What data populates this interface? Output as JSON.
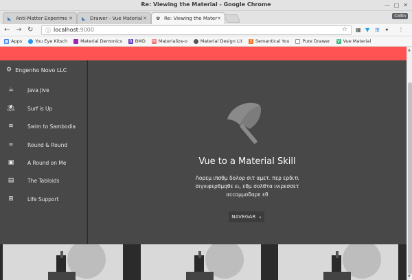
{
  "window": {
    "title": "Re: Viewing the Material - Google Chrome"
  },
  "tabs": [
    {
      "label": "Anti-Matter Experime",
      "active": false
    },
    {
      "label": "Drawer - Vue Material",
      "active": false
    },
    {
      "label": "Re: Viewing the Mater",
      "active": true
    }
  ],
  "profile": "Collin",
  "toolbar": {
    "url_host": "localhost",
    "url_port": ":9000"
  },
  "bookmarks": [
    {
      "label": "Apps",
      "icon": "apps-grid-icon",
      "color": "#4285f4"
    },
    {
      "label": "You Eye Kitsch",
      "icon": "swirl-icon",
      "color": "#2196f3"
    },
    {
      "label": "Material Demonics",
      "icon": "material-icon",
      "color": "#9c27b0"
    },
    {
      "label": "BMD",
      "icon": "bmd-icon",
      "color": "#673ab7"
    },
    {
      "label": "Materialize-o",
      "icon": "materialize-icon",
      "color": "#ee6e73"
    },
    {
      "label": "Material Design Lit",
      "icon": "mdl-icon",
      "color": "#555555"
    },
    {
      "label": "Semantical You",
      "icon": "semantic-icon",
      "color": "#f2711c"
    },
    {
      "label": "Pure Drawer",
      "icon": "page-icon",
      "color": "#888888"
    },
    {
      "label": "Vue Material",
      "icon": "vue-icon",
      "color": "#41b883"
    }
  ],
  "page": {
    "accent_color": "#ff5252",
    "brand": "Engenho Novo LLC",
    "menu": [
      {
        "label": "Java Jive",
        "icon": "coffee-icon"
      },
      {
        "label": "Surf is Up",
        "icon": "beach-umbrella-icon"
      },
      {
        "label": "Swim to Sambodia",
        "icon": "pool-icon"
      },
      {
        "label": "Round & Round",
        "icon": "infinity-icon"
      },
      {
        "label": "A Round on Me",
        "icon": "kitchen-icon"
      },
      {
        "label": "The Tabloids",
        "icon": "chrome-reader-icon"
      },
      {
        "label": "Life Support",
        "icon": "add-box-icon"
      }
    ],
    "hero": {
      "title": "Vue to a Material Skill",
      "text": "Λορεμ ιπσθμ δολορ σιτ αμετ. περ ερδιτι σιγνιφερθμqθε ει, εθμ σολθτα ινιρεσσετ αccομμοδαρε εθ",
      "cta": "NAVEGAR"
    }
  }
}
